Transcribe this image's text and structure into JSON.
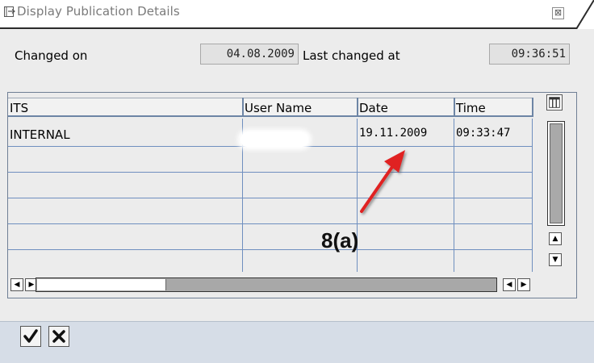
{
  "window": {
    "title": "Display Publication Details",
    "close_symbol": "⊠"
  },
  "header": {
    "changed_on_label": "Changed on",
    "changed_on_value": "04.08.2009",
    "last_changed_label": "Last changed at",
    "last_changed_value": "09:36:51"
  },
  "table": {
    "columns": [
      "ITS",
      "User Name",
      "Date",
      "Time"
    ],
    "rows": [
      {
        "its": "INTERNAL",
        "user": "",
        "date": "19.11.2009",
        "time": "09:33:47"
      },
      {
        "its": "",
        "user": "",
        "date": "",
        "time": ""
      },
      {
        "its": "",
        "user": "",
        "date": "",
        "time": ""
      },
      {
        "its": "",
        "user": "",
        "date": "",
        "time": ""
      },
      {
        "its": "",
        "user": "",
        "date": "",
        "time": ""
      },
      {
        "its": "",
        "user": "",
        "date": "",
        "time": ""
      }
    ]
  },
  "annotation": {
    "label": "8(a)",
    "arrow_color": "#e02020"
  },
  "footer": {
    "confirm_icon": "checkmark-icon",
    "cancel_icon": "cross-icon"
  },
  "icons": {
    "title": "window-menu-icon",
    "column_settings": "column-settings-icon",
    "scroll_up": "arrow-up-icon",
    "scroll_down": "arrow-down-icon",
    "scroll_left": "arrow-left-icon",
    "scroll_right": "arrow-right-icon"
  }
}
